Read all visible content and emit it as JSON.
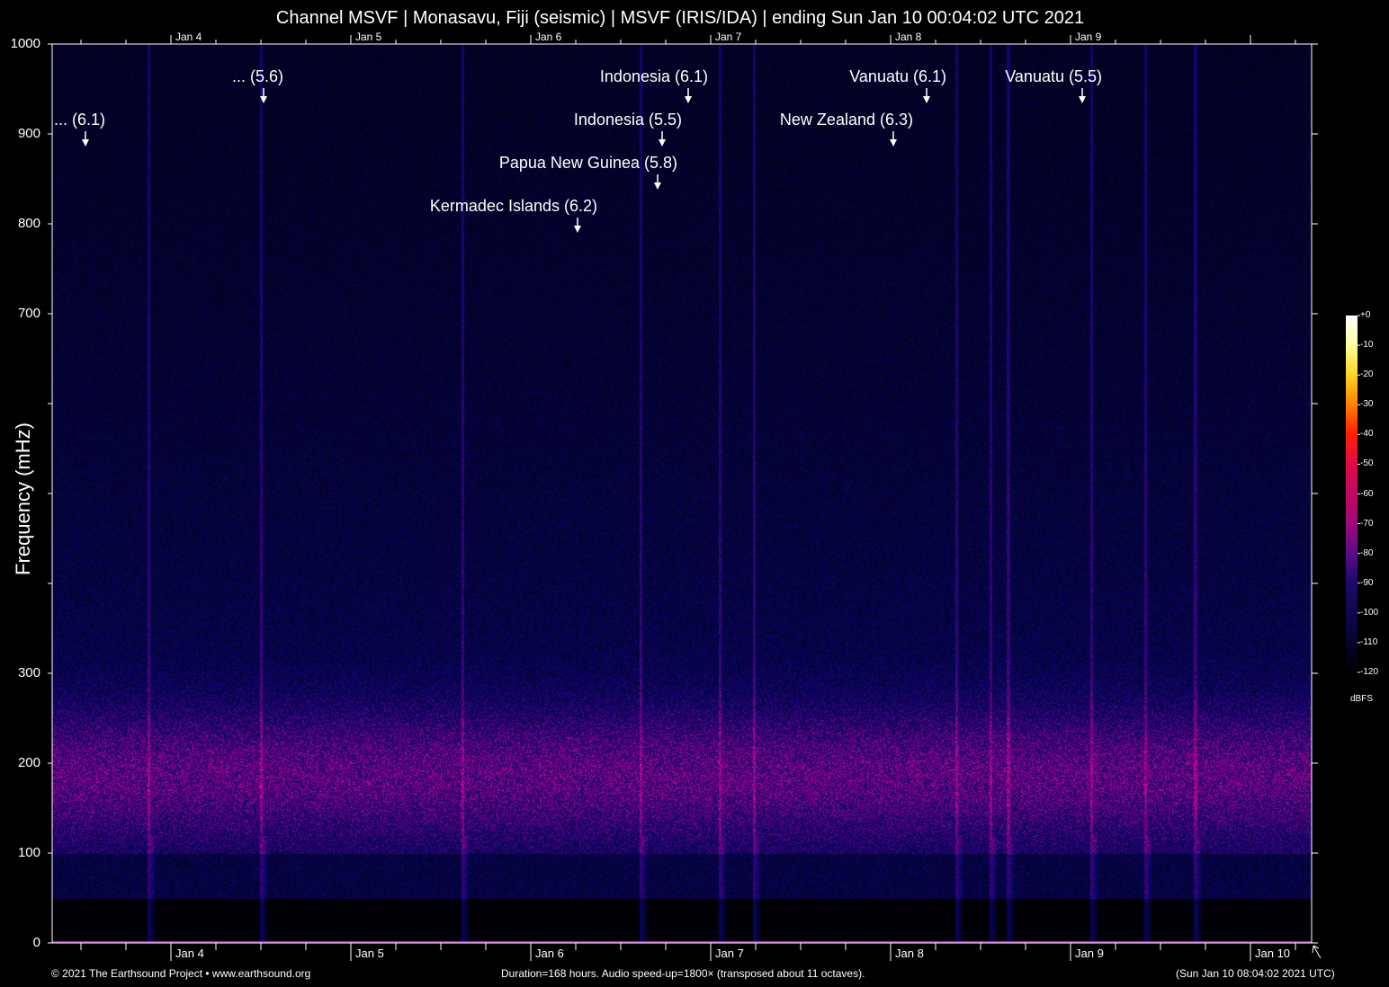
{
  "title": "Channel MSVF | Monasavu, Fiji (seismic) | MSVF (IRIS/IDA) | ending Sun Jan 10 00:04:02 UTC 2021",
  "footer": {
    "copyright": "© 2021 The Earthsound Project • www.earthsound.org",
    "info": "Duration=168 hours. Audio speed-up=1800× (transposed about 11 octaves).",
    "end_time": "(Sun Jan 10 08:04:02 2021 UTC)"
  },
  "chart_data": {
    "type": "heatmap",
    "title": "Channel MSVF | Monasavu, Fiji (seismic) | MSVF (IRIS/IDA) | ending Sun Jan 10 00:04:02 UTC 2021",
    "ylabel": "Frequency (mHz)",
    "ylim": [
      0,
      1000
    ],
    "y_ticks": [
      0,
      100,
      200,
      300,
      400,
      500,
      600,
      700,
      800,
      900,
      1000
    ],
    "y_tick_labels": [
      "0",
      "100",
      "200",
      "300",
      "",
      "",
      "",
      "700",
      "800",
      "900",
      "1000"
    ],
    "x_unit": "days since Jan 4 00:00 UTC",
    "xlim": [
      -0.66,
      6.34
    ],
    "x_ticks": [
      0,
      1,
      2,
      3,
      4,
      5,
      6
    ],
    "x_tick_labels": [
      "Jan 4",
      "Jan 5",
      "Jan 6",
      "Jan 7",
      "Jan 8",
      "Jan 9",
      "Jan 10"
    ],
    "top_tick_labels": [
      "Jan 4",
      "Jan 5",
      "Jan 6",
      "Jan 7",
      "Jan 8",
      "Jan 9"
    ],
    "colorbar": {
      "label": "dBFS",
      "range": [
        -120,
        0
      ],
      "ticks": [
        "+0",
        "-10",
        "-20",
        "-30",
        "-40",
        "-50",
        "-60",
        "-70",
        "-80",
        "-90",
        "-100",
        "-110",
        "-120"
      ]
    },
    "events": [
      {
        "label": "... (6.1)",
        "day": -0.475
      },
      {
        "label": "... (5.6)",
        "day": 0.515
      },
      {
        "label": "Indonesia (6.1)",
        "day": 2.875
      },
      {
        "label": "Indonesia (5.5)",
        "day": 2.73
      },
      {
        "label": "Papua New Guinea (5.8)",
        "day": 2.705
      },
      {
        "label": "Kermadec Islands (6.2)",
        "day": 2.26
      },
      {
        "label": "New Zealand (6.3)",
        "day": 4.015
      },
      {
        "label": "Vanuatu (6.1)",
        "day": 4.2
      },
      {
        "label": "Vanuatu (5.5)",
        "day": 5.065
      }
    ],
    "streak_days": [
      -0.125,
      2.61,
      3.05,
      3.24,
      4.365,
      4.555,
      5.115,
      5.69,
      5.415,
      1.62,
      0.5,
      4.65
    ]
  }
}
